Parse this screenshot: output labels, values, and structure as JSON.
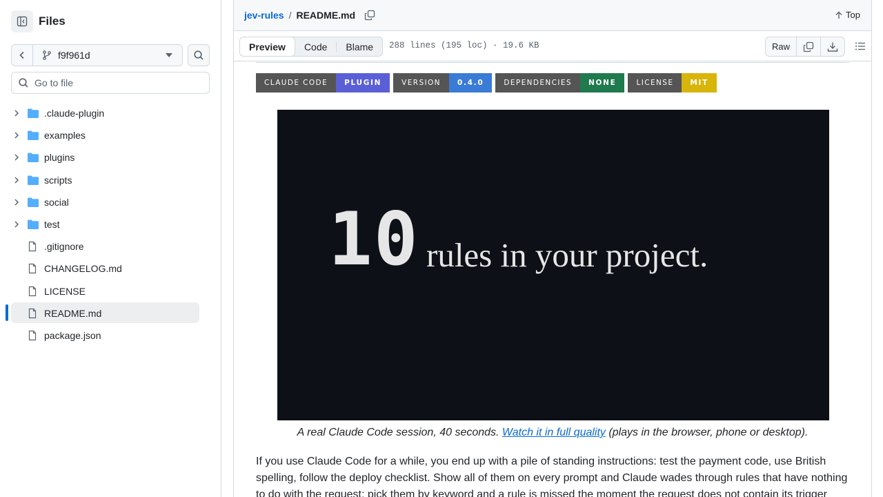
{
  "sidebar": {
    "title": "Files",
    "branch": "f9f961d",
    "goto_placeholder": "Go to file",
    "items": [
      {
        "label": ".claude-plugin",
        "type": "folder"
      },
      {
        "label": "examples",
        "type": "folder"
      },
      {
        "label": "plugins",
        "type": "folder"
      },
      {
        "label": "scripts",
        "type": "folder"
      },
      {
        "label": "social",
        "type": "folder"
      },
      {
        "label": "test",
        "type": "folder"
      },
      {
        "label": ".gitignore",
        "type": "file"
      },
      {
        "label": "CHANGELOG.md",
        "type": "file"
      },
      {
        "label": "LICENSE",
        "type": "file"
      },
      {
        "label": "README.md",
        "type": "file",
        "selected": true
      },
      {
        "label": "package.json",
        "type": "file"
      }
    ]
  },
  "header": {
    "repo": "jev-rules",
    "separator": "/",
    "file": "README.md",
    "top_label": "Top"
  },
  "filebar": {
    "tabs": [
      "Preview",
      "Code",
      "Blame"
    ],
    "active_tab": "Preview",
    "meta": "288 lines (195 loc) · 19.6 KB",
    "raw_label": "Raw"
  },
  "badges": [
    {
      "key": "CLAUDE CODE",
      "value": "PLUGIN",
      "color": "#5b5fd6"
    },
    {
      "key": "VERSION",
      "value": "0.4.0",
      "color": "#3a7bd5"
    },
    {
      "key": "DEPENDENCIES",
      "value": "NONE",
      "color": "#1f7a4d"
    },
    {
      "key": "LICENSE",
      "value": "MIT",
      "color": "#d8b50a"
    }
  ],
  "video": {
    "number": "10",
    "text": "rules in your project."
  },
  "caption": {
    "before": "A real Claude Code session, 40 seconds. ",
    "link": "Watch it in full quality",
    "after": " (plays in the browser, phone or desktop)."
  },
  "paragraph": "If you use Claude Code for a while, you end up with a pile of standing instructions: test the payment code, use British spelling, follow the deploy checklist. Show all of them on every prompt and Claude wades through rules that have nothing to do with the request; pick them by keyword and a rule is missed the moment the request does not contain its trigger",
  "colors": {
    "accent": "#0969da",
    "border": "#d1d9e0",
    "folder": "#54aeff"
  }
}
